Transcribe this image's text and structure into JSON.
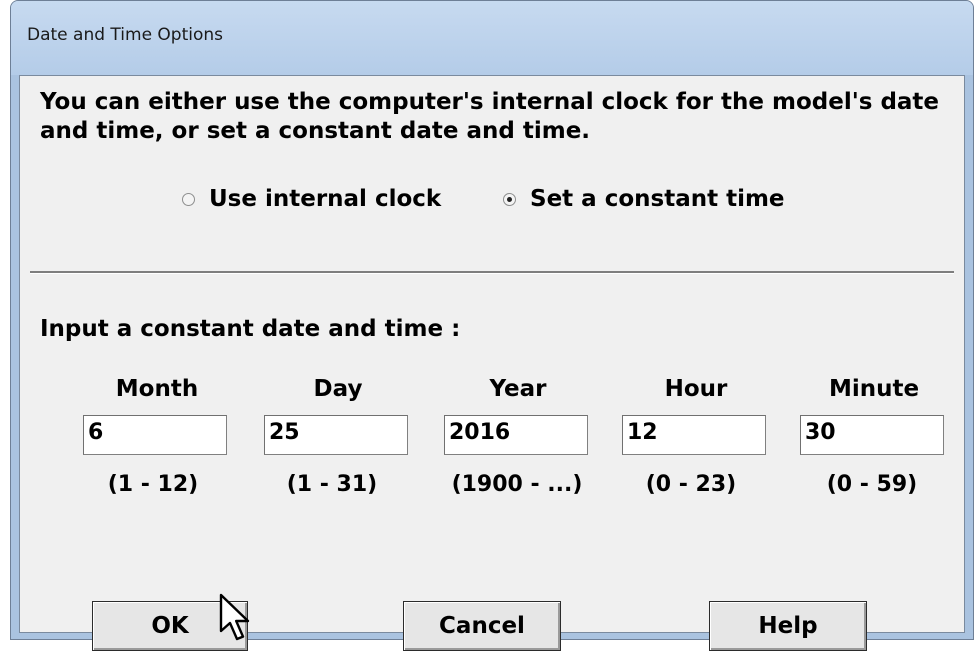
{
  "window": {
    "title": "Date and Time Options"
  },
  "intro_text": "You can either use the computer's internal clock for the model's date and time, or set a constant date and time.",
  "radios": [
    {
      "label": "Use internal clock",
      "selected": false
    },
    {
      "label": "Set a constant time",
      "selected": true
    }
  ],
  "input_label": "Input a constant date and time :",
  "fields": [
    {
      "header": "Month",
      "value": "6",
      "range": "(1 - 12)"
    },
    {
      "header": "Day",
      "value": "25",
      "range": "(1 - 31)"
    },
    {
      "header": "Year",
      "value": "2016",
      "range": "(1900 - ...)"
    },
    {
      "header": "Hour",
      "value": "12",
      "range": "(0 - 23)"
    },
    {
      "header": "Minute",
      "value": "30",
      "range": "(0 - 59)"
    }
  ],
  "buttons": {
    "ok": "OK",
    "cancel": "Cancel",
    "help": "Help"
  },
  "icons": {
    "cursor": "mouse-pointer-icon"
  },
  "colors": {
    "titlebar": "#b9cfe9",
    "client_bg": "#f0f0f0",
    "button_bg": "#e6e6e6"
  }
}
